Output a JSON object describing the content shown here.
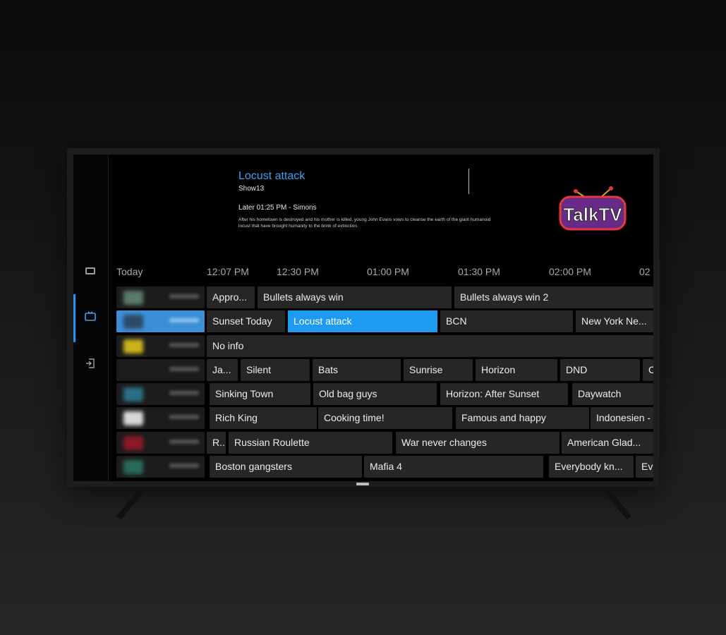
{
  "program_info": {
    "title": "Locust attack",
    "episode": "Show13",
    "later": "Later 01:25 PM - Simons",
    "description": "After his hometown is destroyed and his mother is killed, young John Evans vows to cleanse the earth of the giant humanoid locust that have brought humanity to the brink of extinction."
  },
  "brand": {
    "logo_text": "TalkTV"
  },
  "sidebar": {
    "items": [
      {
        "icon": "tv-icon",
        "active": false
      },
      {
        "icon": "live-tv-icon",
        "active": true
      },
      {
        "icon": "exit-icon",
        "active": false
      }
    ]
  },
  "timeline": {
    "labels": [
      "Today",
      "12:07 PM",
      "12:30 PM",
      "01:00 PM",
      "01:30 PM",
      "02:00 PM",
      "02"
    ]
  },
  "guide": {
    "rows": [
      {
        "channel_color": "#5a7a6a",
        "active": false,
        "programs": [
          "Appro...",
          "Bullets always win",
          "Bullets always win 2"
        ]
      },
      {
        "channel_color": "#2d4a66",
        "active": true,
        "programs": [
          "Sunset Today",
          "Locust attack",
          "BCN",
          "New York Ne..."
        ]
      },
      {
        "channel_color": "#c9b21a",
        "active": false,
        "programs": [
          "No info"
        ]
      },
      {
        "channel_color": "#1c1c1c",
        "active": false,
        "programs": [
          "Ja...",
          "Silent",
          "Bats",
          "Sunrise",
          "Horizon",
          "DND",
          "C"
        ]
      },
      {
        "channel_color": "#2b6f86",
        "active": false,
        "programs": [
          "Sinking Town",
          "Old bag guys",
          "Horizon: After Sunset",
          "Daywatch"
        ]
      },
      {
        "channel_color": "#d8d8d8",
        "active": false,
        "programs": [
          "Rich King",
          "Cooking time!",
          "Famous and happy",
          "Indonesien -"
        ]
      },
      {
        "channel_color": "#8a1a2a",
        "active": false,
        "programs": [
          "R...",
          "Russian Roulette",
          "War never changes",
          "American Glad..."
        ]
      },
      {
        "channel_color": "#2a6a5a",
        "active": false,
        "programs": [
          "Boston gangsters",
          "Mafia 4",
          "Everybody kn...",
          "Ev"
        ]
      }
    ]
  },
  "colors": {
    "accent": "#1e9bf0",
    "title": "#3aa0f3",
    "program_bg": "#262626"
  }
}
